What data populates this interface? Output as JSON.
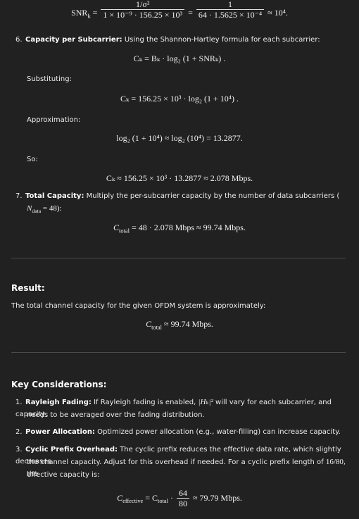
{
  "top_eq": {
    "lhs": "SNR",
    "lhs_sub": "k",
    "num1": "1/σ²",
    "den1": "1 × 10⁻⁹ · 156.25 × 10³",
    "num2": "1",
    "den2": "64 · 1.5625 × 10⁻⁴",
    "rhs": "≈ 10⁴."
  },
  "step6": {
    "number": "6.",
    "title": "Capacity per Subcarrier:",
    "text": "Using the Shannon-Hartley formula for each subcarrier:",
    "formula": "Cₖ = Bₖ · log₂ (1 + SNRₖ) .",
    "substituting_label": "Substituting:",
    "substituting_formula": "Cₖ = 156.25 × 10³ · log₂ (1 + 10⁴) .",
    "approx_label": "Approximation:",
    "approx_formula": "log₂ (1 + 10⁴) ≈ log₂ (10⁴) = 13.2877.",
    "so_label": "So:",
    "so_formula": "Cₖ ≈ 156.25 × 10³ · 13.2877 ≈ 2.078 Mbps."
  },
  "step7": {
    "number": "7.",
    "title": "Total Capacity:",
    "text": "Multiply the per-subcarrier capacity by the number of data subcarriers (",
    "text2": "N",
    "text2_sub": "data",
    "text2_rest": "= 48):",
    "formula": "C",
    "formula_sub": "total",
    "formula_rest": "= 48 · 2.078 Mbps ≈ 99.74 Mbps."
  },
  "result": {
    "heading": "Result:",
    "text": "The total channel capacity for the given OFDM system is approximately:",
    "formula": "C",
    "formula_sub": "total",
    "formula_rest": "≈ 99.74 Mbps."
  },
  "considerations": {
    "heading": "Key Considerations:",
    "items": [
      {
        "number": "1.",
        "title": "Rayleigh Fading:",
        "text_a": "If Rayleigh fading is enabled,",
        "math": "|Hₖ|²",
        "text_b": "will vary for each subcarrier, and capacity",
        "text_c": "needs to be averaged over the fading distribution."
      },
      {
        "number": "2.",
        "title": "Power Allocation:",
        "text_a": "Optimized power allocation (e.g., water-filling) can increase capacity."
      },
      {
        "number": "3.",
        "title": "Cyclic Prefix Overhead:",
        "text_a": "The cyclic prefix reduces the effective data rate, which slightly decreases",
        "text_b": "the channel capacity. Adjust for this overhead if needed. For a cyclic prefix length of",
        "math": "16/80",
        "text_b_end": ", the",
        "text_c": "effective capacity is:"
      }
    ],
    "final_formula": {
      "lhs": "C",
      "lhs_sub": "effective",
      "mid": "= C",
      "mid_sub": "total",
      "dot": "·",
      "num": "64",
      "den": "80",
      "rhs": "≈ 79.79 Mbps."
    }
  }
}
